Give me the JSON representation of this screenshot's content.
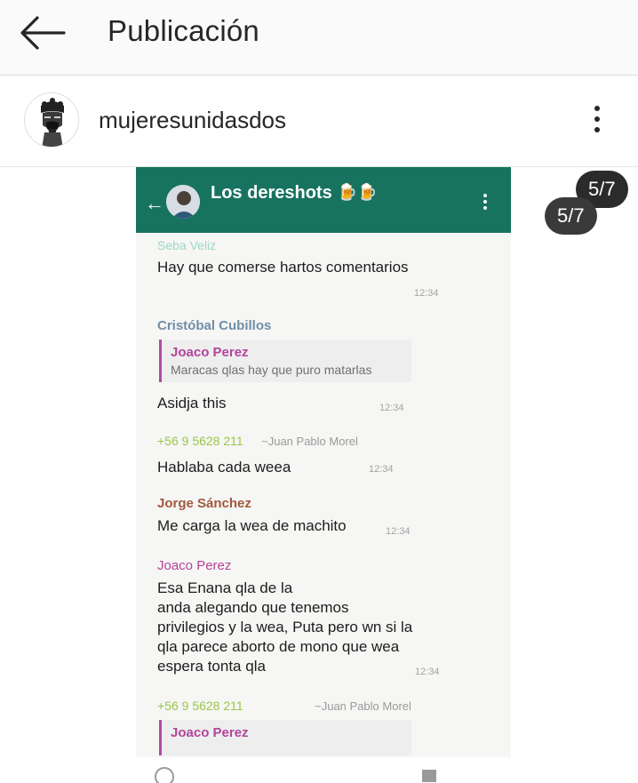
{
  "app_bar": {
    "title": "Publicación"
  },
  "post": {
    "username": "mujeresunidasdos"
  },
  "carousel": {
    "counter_back": "5/7",
    "counter_front": "5/7"
  },
  "chat": {
    "title": "Los dereshots",
    "title_emoji": "🍺🍺",
    "messages": [
      {
        "sender": "Seba Veliz",
        "sender_color": "#9fd8c5",
        "text": "Hay que comerse hartos comentarios",
        "time": "12:34"
      },
      {
        "sender": "Cristóbal Cubillos",
        "sender_color": "#6f8fa8",
        "quote_name": "Joaco Perez",
        "quote_text": "Maracas qlas hay que puro matarlas",
        "text": "Asidja this",
        "time": "12:34"
      },
      {
        "sender": "+56 9 5628 211",
        "sender_color": "#9ac64a",
        "alias": "~Juan Pablo Morel",
        "text": "Hablaba cada weea",
        "time": "12:34"
      },
      {
        "sender": "Jorge Sánchez",
        "sender_color": "#a05a3e",
        "text": "Me carga la wea de machito",
        "time": "12:34"
      },
      {
        "sender": "Joaco Perez",
        "sender_color": "#b2449a",
        "text_lines": [
          "Esa Enana qla de la",
          "anda alegando que tenemos",
          "privilegios y la wea, Puta pero wn si la",
          "qla parece aborto de mono que wea",
          "espera tonta qla"
        ],
        "time": "12:34"
      },
      {
        "sender": "+56 9 5628 211",
        "sender_color": "#9ac64a",
        "alias": "~Juan Pablo Morel",
        "quote_name": "Joaco Perez"
      }
    ]
  }
}
